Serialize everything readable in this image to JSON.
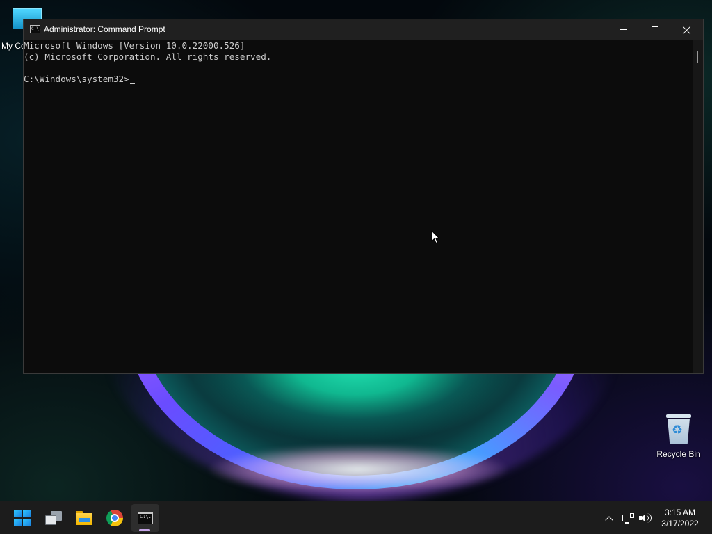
{
  "desktop": {
    "icons": {
      "my_computer": {
        "label": "My Co"
      },
      "recycle_bin": {
        "label": "Recycle Bin"
      }
    }
  },
  "cmd_window": {
    "title": "Administrator: Command Prompt",
    "title_icon_text": "C:\\.",
    "console_lines": [
      "Microsoft Windows [Version 10.0.22000.526]",
      "(c) Microsoft Corporation. All rights reserved.",
      "",
      "C:\\Windows\\system32>"
    ],
    "colors": {
      "background": "#0c0c0c",
      "text": "#cccccc",
      "titlebar": "#202020"
    }
  },
  "taskbar": {
    "items": [
      {
        "name": "start",
        "icon": "windows-logo-icon",
        "active": false
      },
      {
        "name": "task-view",
        "icon": "task-view-icon",
        "active": false
      },
      {
        "name": "file-explorer",
        "icon": "folder-icon",
        "active": false
      },
      {
        "name": "chrome",
        "icon": "chrome-icon",
        "active": false
      },
      {
        "name": "command-prompt",
        "icon": "terminal-icon",
        "active": true
      }
    ],
    "tray": {
      "icons": [
        "chevron-up-icon",
        "network-icon",
        "volume-icon"
      ]
    },
    "clock": {
      "time": "3:15 AM",
      "date": "3/17/2022"
    },
    "colors": {
      "background": "#1c1c1c",
      "active_indicator": "#c6a6e8"
    }
  }
}
